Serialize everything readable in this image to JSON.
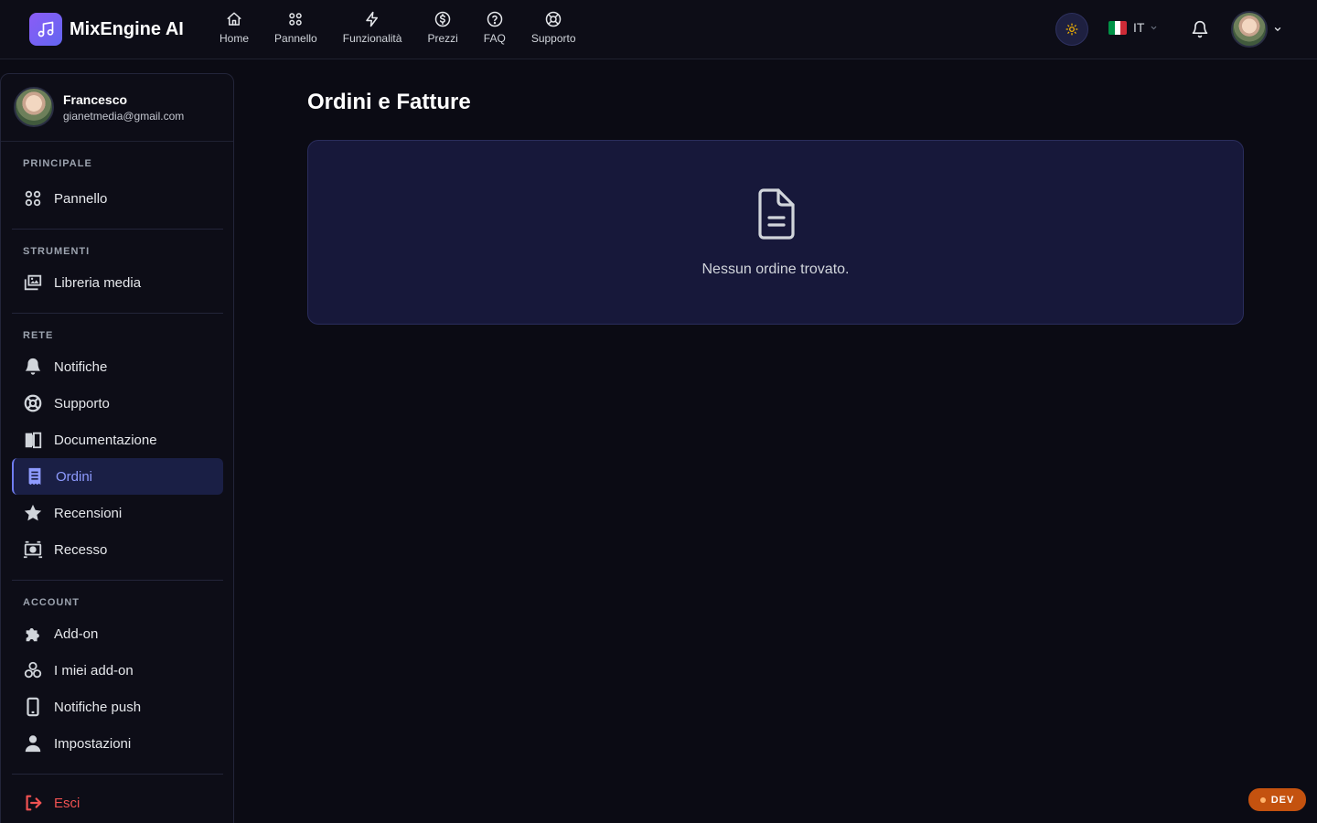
{
  "brand": {
    "name": "MixEngine AI"
  },
  "nav": [
    {
      "label": "Home",
      "icon": "home-icon"
    },
    {
      "label": "Pannello",
      "icon": "grid-icon"
    },
    {
      "label": "Funzionalità",
      "icon": "lightning-icon"
    },
    {
      "label": "Prezzi",
      "icon": "dollar-icon"
    },
    {
      "label": "FAQ",
      "icon": "question-icon"
    },
    {
      "label": "Supporto",
      "icon": "lifebuoy-icon"
    }
  ],
  "language": {
    "code": "IT",
    "flag": [
      "#009246",
      "#ffffff",
      "#ce2b37"
    ]
  },
  "user": {
    "name": "Francesco",
    "email": "gianetmedia@gmail.com"
  },
  "sidebar": {
    "sections": [
      {
        "title": "PRINCIPALE",
        "items": [
          {
            "label": "Pannello",
            "icon": "grid-icon"
          }
        ]
      },
      {
        "title": "STRUMENTI",
        "items": [
          {
            "label": "Libreria media",
            "icon": "photos-icon"
          }
        ]
      },
      {
        "title": "RETE",
        "items": [
          {
            "label": "Notifiche",
            "icon": "bell-icon"
          },
          {
            "label": "Supporto",
            "icon": "lifebuoy-icon"
          },
          {
            "label": "Documentazione",
            "icon": "book-icon"
          },
          {
            "label": "Ordini",
            "icon": "receipt-icon",
            "active": true
          },
          {
            "label": "Recensioni",
            "icon": "star-icon"
          },
          {
            "label": "Recesso",
            "icon": "money-icon"
          }
        ]
      },
      {
        "title": "ACCOUNT",
        "items": [
          {
            "label": "Add-on",
            "icon": "puzzle-icon"
          },
          {
            "label": "I miei add-on",
            "icon": "shapes-icon"
          },
          {
            "label": "Notifiche push",
            "icon": "phone-icon"
          },
          {
            "label": "Impostazioni",
            "icon": "user-icon"
          }
        ]
      }
    ],
    "logout": {
      "label": "Esci",
      "icon": "logout-icon"
    }
  },
  "main": {
    "title": "Ordini e Fatture",
    "empty_message": "Nessun ordine trovato."
  },
  "env_badge": "DEV",
  "colors": {
    "accent": "#6f7cf0",
    "logout": "#f05252",
    "dev": "#c4520f"
  }
}
